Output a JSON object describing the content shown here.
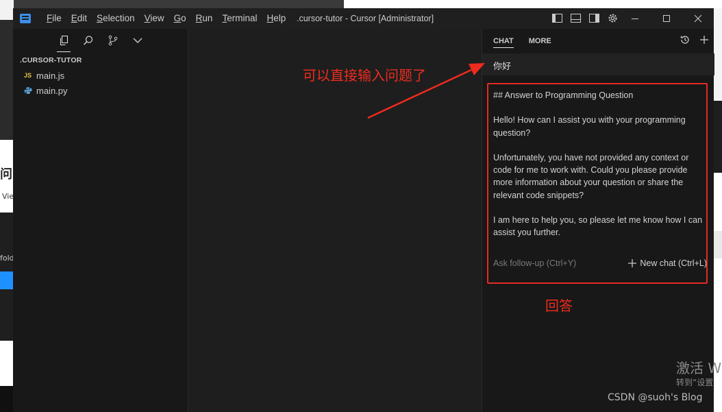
{
  "window": {
    "title": ".cursor-tutor - Cursor [Administrator]",
    "menu": [
      {
        "label": "File",
        "mnemonic": "F",
        "rest": "ile"
      },
      {
        "label": "Edit",
        "mnemonic": "E",
        "rest": "dit"
      },
      {
        "label": "Selection",
        "mnemonic": "S",
        "rest": "election"
      },
      {
        "label": "View",
        "mnemonic": "V",
        "rest": "iew"
      },
      {
        "label": "Go",
        "mnemonic": "G",
        "rest": "o"
      },
      {
        "label": "Run",
        "mnemonic": "R",
        "rest": "un"
      },
      {
        "label": "Terminal",
        "mnemonic": "T",
        "rest": "erminal"
      },
      {
        "label": "Help",
        "mnemonic": "H",
        "rest": "elp"
      }
    ]
  },
  "sidebar": {
    "folder": ".CURSOR-TUTOR",
    "files": [
      {
        "name": "main.js",
        "icon": "JS"
      },
      {
        "name": "main.py",
        "icon": "python-icon"
      }
    ]
  },
  "chat": {
    "tabs": [
      "CHAT",
      "MORE"
    ],
    "user_message": "你好",
    "answer": [
      "## Answer to Programming Question",
      "Hello! How can I assist you with your programming question?",
      "Unfortunately, you have not provided any context or code for me to work with. Could you please provide more information about your question or share the relevant code snippets?",
      "I am here to help you, so please let me know how I can assist you further."
    ],
    "followup_placeholder": "Ask follow-up (Ctrl+Y)",
    "new_chat_label": "New chat (Ctrl+L)"
  },
  "annotations": {
    "arrow_label": "可以直接输入问题了",
    "box_label": "回答",
    "color": "#f02b1e"
  },
  "background": {
    "left_fragments": [
      "问中",
      "Vie",
      "fold"
    ],
    "right_watermark_line1": "激活 W",
    "right_watermark_line2": "转到“设置",
    "csdn": "CSDN @suoh's Blog"
  }
}
